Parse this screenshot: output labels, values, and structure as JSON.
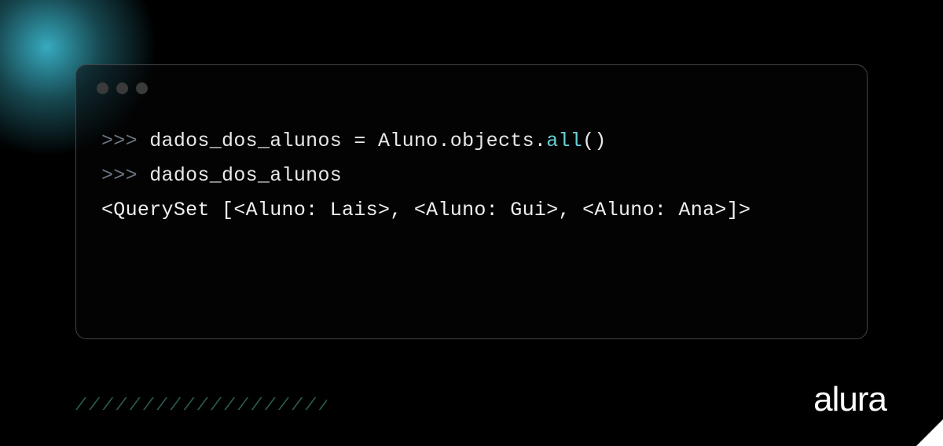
{
  "terminal": {
    "lines": [
      {
        "prompt": ">>> ",
        "code_pre": "dados_dos_alunos = Aluno.objects.",
        "code_highlight": "all",
        "code_post": "()"
      },
      {
        "prompt": ">>> ",
        "code_pre": "dados_dos_alunos",
        "code_highlight": "",
        "code_post": ""
      }
    ],
    "output": "<QuerySet [<Aluno: Lais>, <Aluno: Gui>, <Aluno: Ana>]>"
  },
  "decor": {
    "hatch": "/////////////////////"
  },
  "brand": {
    "name": "alura"
  }
}
